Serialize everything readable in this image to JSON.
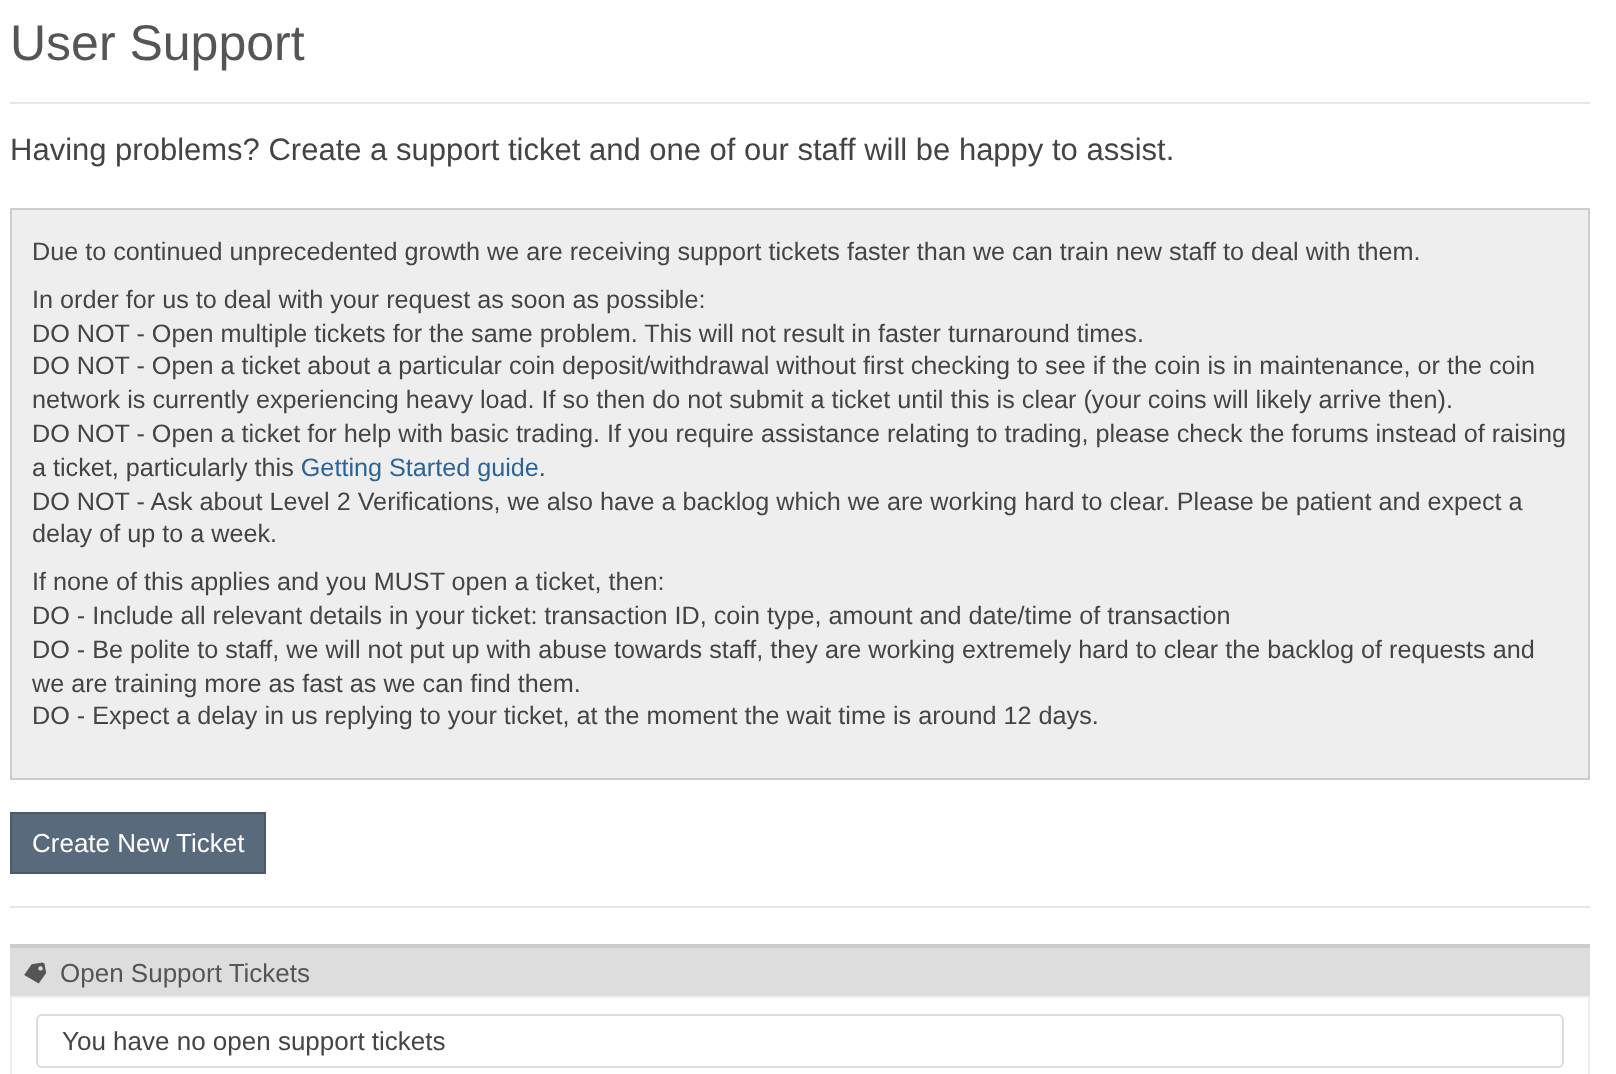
{
  "page_title": "User Support",
  "intro": "Having problems? Create a support ticket and one of our staff will be happy to assist.",
  "notice": {
    "paragraphs": [
      {
        "lines": [
          {
            "text": "Due to continued unprecedented growth we are receiving support tickets faster than we can train new staff to deal with them."
          }
        ]
      },
      {
        "lines": [
          {
            "text": "In order for us to deal with your request as soon as possible:"
          },
          {
            "text": "DO NOT - Open multiple tickets for the same problem. This will not result in faster turnaround times."
          },
          {
            "text": "DO NOT - Open a ticket about a particular coin deposit/withdrawal without first checking to see if the coin is in maintenance, or the coin network is currently experiencing heavy load. If so then do not submit a ticket until this is clear (your coins will likely arrive then)."
          },
          {
            "text": "DO NOT - Open a ticket for help with basic trading. If you require assistance relating to trading, please check the forums instead of raising a ticket, particularly this ",
            "link": "Getting Started guide",
            "after": "."
          },
          {
            "text": "DO NOT - Ask about Level 2 Verifications, we also have a backlog which we are working hard to clear. Please be patient and expect a delay of up to a week."
          }
        ]
      },
      {
        "lines": [
          {
            "text": "If none of this applies and you MUST open a ticket, then:"
          },
          {
            "text": "DO - Include all relevant details in your ticket: transaction ID, coin type, amount and date/time of transaction"
          },
          {
            "text": "DO - Be polite to staff, we will not put up with abuse towards staff, they are working extremely hard to clear the backlog of requests and we are training more as fast as we can find them."
          },
          {
            "text": "DO - Expect a delay in us replying to your ticket, at the moment the wait time is around 12 days."
          }
        ]
      }
    ]
  },
  "create_button": "Create New Ticket",
  "open_tickets": {
    "title": "Open Support Tickets",
    "message": "You have no open support tickets"
  }
}
